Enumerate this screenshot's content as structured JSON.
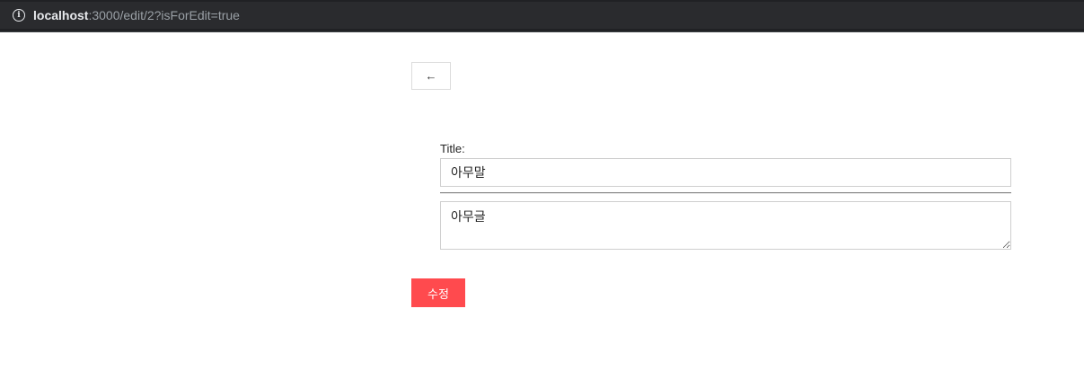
{
  "browser": {
    "url_host": "localhost",
    "url_rest": ":3000/edit/2?isForEdit=true",
    "info_icon": "info-icon"
  },
  "page": {
    "back_button_label": "←",
    "title_label": "Title:",
    "title_value": "아무말",
    "body_value": "아무글",
    "submit_label": "수정",
    "accent_color": "#ff4a4e"
  }
}
